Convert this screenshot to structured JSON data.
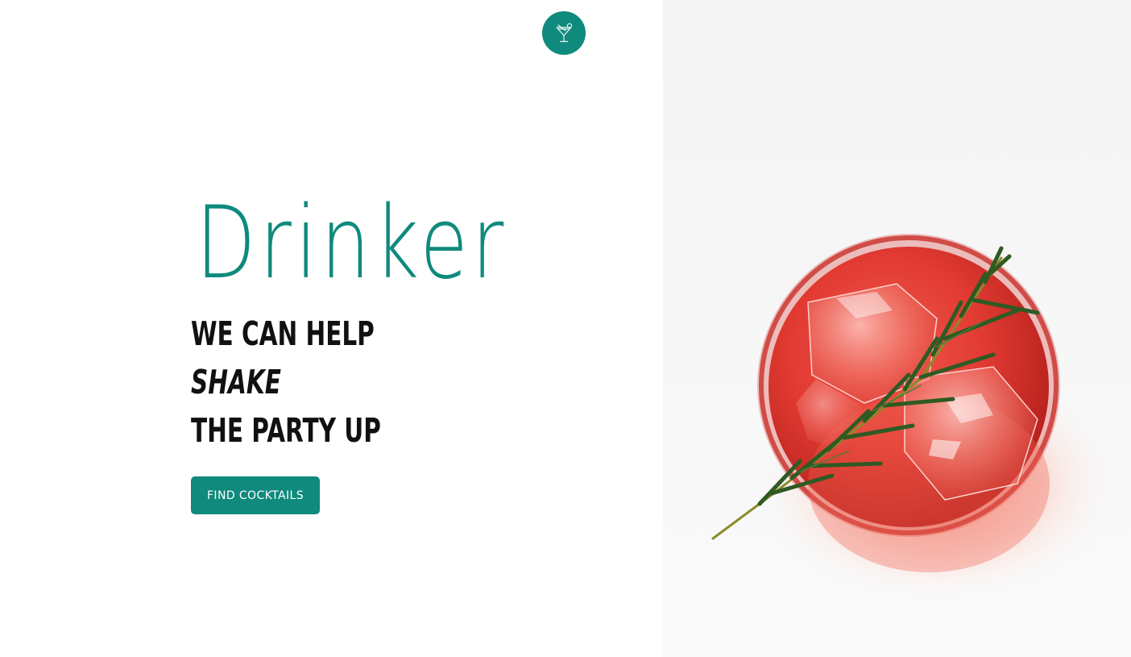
{
  "header": {
    "logo_icon": "cocktail-glass-icon"
  },
  "hero": {
    "brand": "Drinker",
    "tagline": {
      "line1": "WE CAN HELP",
      "line2": "SHAKE",
      "line3": "THE PARTY UP"
    },
    "cta_label": "FIND COCKTAILS",
    "photo_subject": "red-cocktail-with-rosemary-photo"
  },
  "colors": {
    "accent": "#0f8a7d",
    "text": "#111111",
    "background": "#ffffff",
    "drink": "#e8413a"
  }
}
